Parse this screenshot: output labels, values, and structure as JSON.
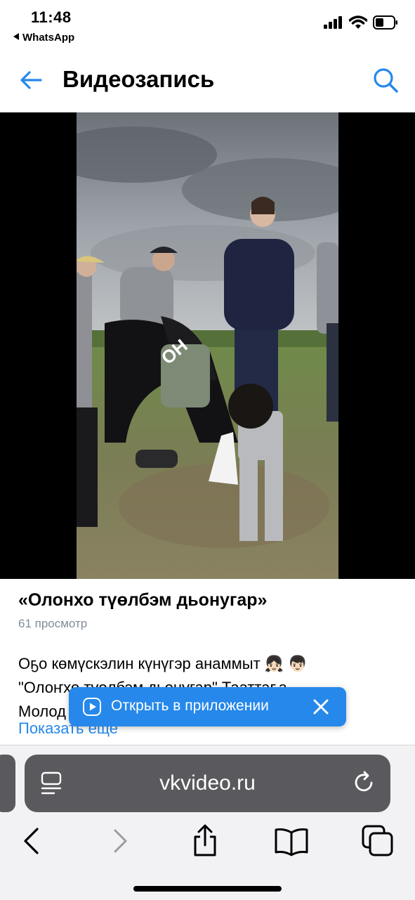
{
  "status_bar": {
    "time": "11:48",
    "back_app": "WhatsApp"
  },
  "header": {
    "title": "Видеозапись",
    "back_icon": "arrow-left-icon",
    "search_icon": "search-icon"
  },
  "video": {
    "title": "«Олонхо түөлбэм дьонугар»",
    "views": "61 просмотр",
    "description_lines": [
      "Оҕо көмүскэлин күнүгэр анаммыт 👧🏻 👦🏻",
      "\"Олоҥхо түөлбэм дьонугар\" Тааттаҕа",
      "Молод"
    ],
    "show_more": "Показать еще"
  },
  "open_app_banner": {
    "label": "Открыть в приложении"
  },
  "browser": {
    "url": "vkvideo.ru"
  },
  "colors": {
    "accent": "#2688eb",
    "secondary_text": "#818c99",
    "url_bar": "#5a5a5e"
  }
}
